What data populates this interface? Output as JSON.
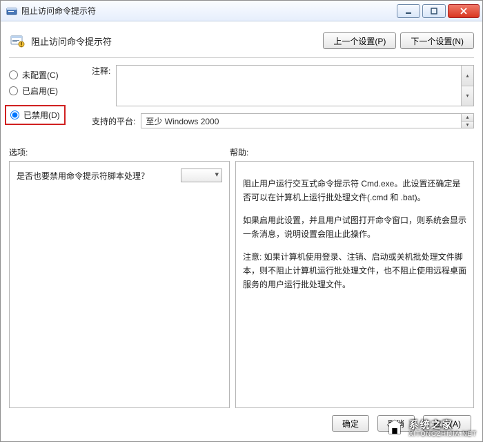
{
  "window": {
    "title": "阻止访问命令提示符"
  },
  "header": {
    "title": "阻止访问命令提示符",
    "prev_btn": "上一个设置(P)",
    "next_btn": "下一个设置(N)"
  },
  "radios": {
    "not_configured": "未配置(C)",
    "enabled": "已启用(E)",
    "disabled": "已禁用(D)"
  },
  "comment_label": "注释:",
  "platform_label": "支持的平台:",
  "platform_value": "至少 Windows 2000",
  "options_label": "选项:",
  "help_label": "帮助:",
  "option_question": "是否也要禁用命令提示符脚本处理？",
  "help_text": {
    "p1": "阻止用户运行交互式命令提示符 Cmd.exe。此设置还确定是否可以在计算机上运行批处理文件(.cmd 和 .bat)。",
    "p2": "如果启用此设置，并且用户试图打开命令窗口，则系统会显示一条消息，说明设置会阻止此操作。",
    "p3": "注意: 如果计算机使用登录、注销、启动或关机批处理文件脚本，则不阻止计算机运行批处理文件，也不阻止使用远程桌面服务的用户运行批处理文件。"
  },
  "footer": {
    "ok": "确定",
    "cancel": "取消",
    "apply": "应用(A)"
  },
  "watermark": {
    "cn": "系统之家",
    "en": "XITONGZHIJIA.NET"
  }
}
